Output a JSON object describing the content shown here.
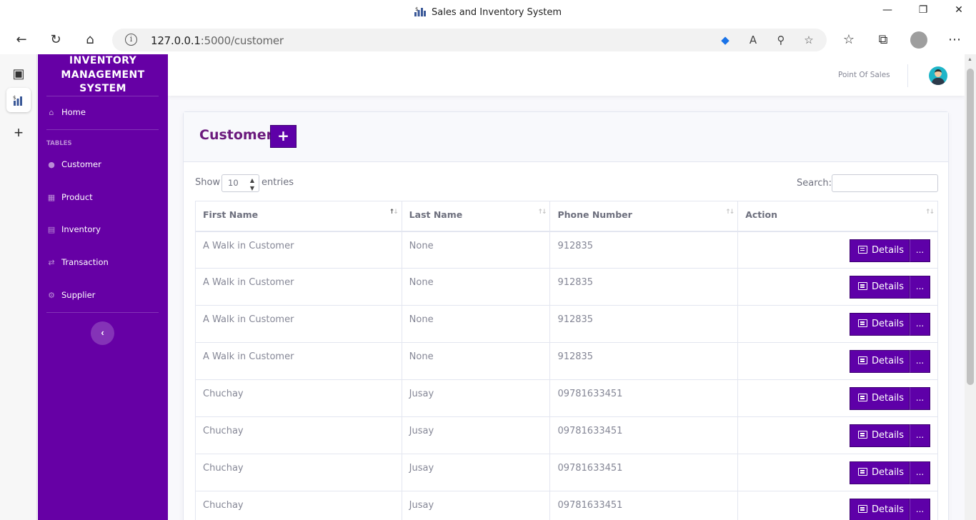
{
  "browser": {
    "window_title": "Sales and Inventory System",
    "url_host": "127.0.0.1",
    "url_path": ":5000/customer",
    "minimize": "—",
    "restore": "❐",
    "close": "✕"
  },
  "sidebar": {
    "brand_line1": "INVENTORY",
    "brand_line2": "MANAGEMENT",
    "brand_line3": "SYSTEM",
    "home": "Home",
    "section_heading": "TABLES",
    "items": [
      {
        "label": "Customer",
        "icon": "user-icon"
      },
      {
        "label": "Product",
        "icon": "table-icon"
      },
      {
        "label": "Inventory",
        "icon": "archive-icon"
      },
      {
        "label": "Transaction",
        "icon": "retweet-icon"
      },
      {
        "label": "Supplier",
        "icon": "cogs-icon"
      }
    ],
    "collapse": "‹"
  },
  "topnav": {
    "pos_link": "Point Of Sales"
  },
  "card": {
    "title": "Customer",
    "add_label": "+"
  },
  "datatable": {
    "show_label": "Show",
    "page_length": "10",
    "entries_label": "entries",
    "search_label": "Search:",
    "search_value": "",
    "columns": [
      "First Name",
      "Last Name",
      "Phone Number",
      "Action"
    ],
    "rows": [
      {
        "first": "A Walk in Customer",
        "last": "None",
        "phone": "912835"
      },
      {
        "first": "A Walk in Customer",
        "last": "None",
        "phone": "912835"
      },
      {
        "first": "A Walk in Customer",
        "last": "None",
        "phone": "912835"
      },
      {
        "first": "A Walk in Customer",
        "last": "None",
        "phone": "912835"
      },
      {
        "first": "Chuchay",
        "last": "Jusay",
        "phone": "09781633451"
      },
      {
        "first": "Chuchay",
        "last": "Jusay",
        "phone": "09781633451"
      },
      {
        "first": "Chuchay",
        "last": "Jusay",
        "phone": "09781633451"
      },
      {
        "first": "Chuchay",
        "last": "Jusay",
        "phone": "09781633451"
      }
    ],
    "details_label": "Details",
    "more_label": "..."
  },
  "colors": {
    "sidebar": "#6600a5",
    "primary_button": "#5e00a8",
    "title": "#6b1a7d"
  }
}
